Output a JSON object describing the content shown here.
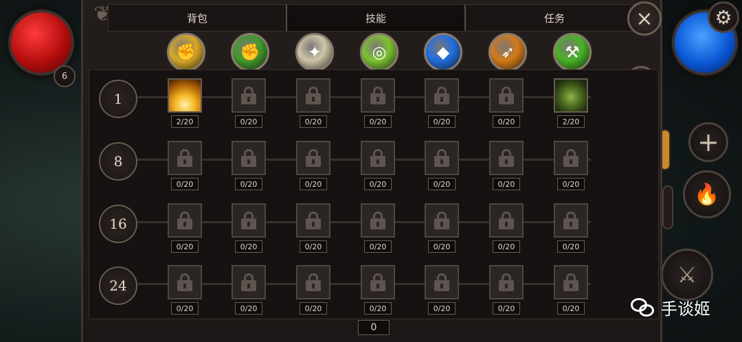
{
  "hud": {
    "player_level": "6"
  },
  "tabs": [
    {
      "label": "背包",
      "active": false
    },
    {
      "label": "技能",
      "active": true
    },
    {
      "label": "任务",
      "active": false
    }
  ],
  "close_icon": "×",
  "categories": [
    {
      "name": "fist-icon",
      "color": "#d7a827"
    },
    {
      "name": "green-fist-icon",
      "color": "#3f9a2a"
    },
    {
      "name": "light-burst-icon",
      "color": "#cfc6a8"
    },
    {
      "name": "green-rune-icon",
      "color": "#7cc230"
    },
    {
      "name": "blue-crystal-icon",
      "color": "#1f6fe0"
    },
    {
      "name": "bow-arrow-icon",
      "color": "#d47a18"
    },
    {
      "name": "green-axe-icon",
      "color": "#48b225"
    }
  ],
  "skill_rows": [
    {
      "level": "1",
      "points": [
        "2/20",
        "0/20",
        "0/20",
        "0/20",
        "0/20",
        "0/20",
        "2/20"
      ],
      "unlocked": [
        true,
        false,
        false,
        false,
        false,
        false,
        true
      ]
    },
    {
      "level": "8",
      "points": [
        "0/20",
        "0/20",
        "0/20",
        "0/20",
        "0/20",
        "0/20",
        "0/20"
      ],
      "unlocked": [
        false,
        false,
        false,
        false,
        false,
        false,
        false
      ]
    },
    {
      "level": "16",
      "points": [
        "0/20",
        "0/20",
        "0/20",
        "0/20",
        "0/20",
        "0/20",
        "0/20"
      ],
      "unlocked": [
        false,
        false,
        false,
        false,
        false,
        false,
        false
      ]
    },
    {
      "level": "24",
      "points": [
        "0/20",
        "0/20",
        "0/20",
        "0/20",
        "0/20",
        "0/20",
        "0/20"
      ],
      "unlocked": [
        false,
        false,
        false,
        false,
        false,
        false,
        false
      ]
    }
  ],
  "available_points": "0",
  "watermark": {
    "text": "手谈姬"
  }
}
